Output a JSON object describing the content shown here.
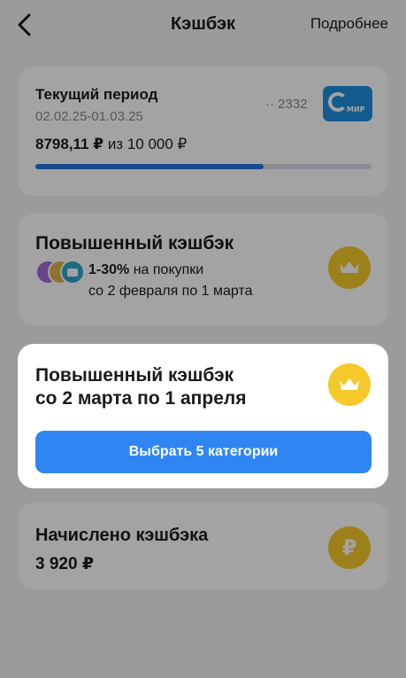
{
  "header": {
    "title": "Кэшбэк",
    "more_label": "Подробнее"
  },
  "period_card": {
    "title": "Текущий период",
    "dates": "02.02.25-01.03.25",
    "card_mask": "·· 2332",
    "card_brand": "МИР",
    "spent": "8798,11 ₽",
    "limit_text": "из 10 000 ₽",
    "progress_fraction": 0.68
  },
  "raised_card": {
    "title": "Повышенный кэшбэк",
    "percent": "1-30%",
    "percent_suffix": "на покупки",
    "period": "со 2 февраля по 1 марта"
  },
  "popup": {
    "title_line1": "Повышенный кэшбэк",
    "title_line2": "со 2 марта по 1 апреля",
    "button_label": "Выбрать 5 категории"
  },
  "accrued_card": {
    "title": "Начислено кэшбэка",
    "value": "3 920 ₽",
    "badge_symbol": "₽"
  },
  "colors": {
    "accent_blue": "#2f86f3",
    "gold": "#f5c92a",
    "progress_fill": "#2a73de"
  },
  "icons": [
    "back-arrow-icon",
    "mir-card-icon",
    "crown-icon",
    "ruble-icon"
  ]
}
